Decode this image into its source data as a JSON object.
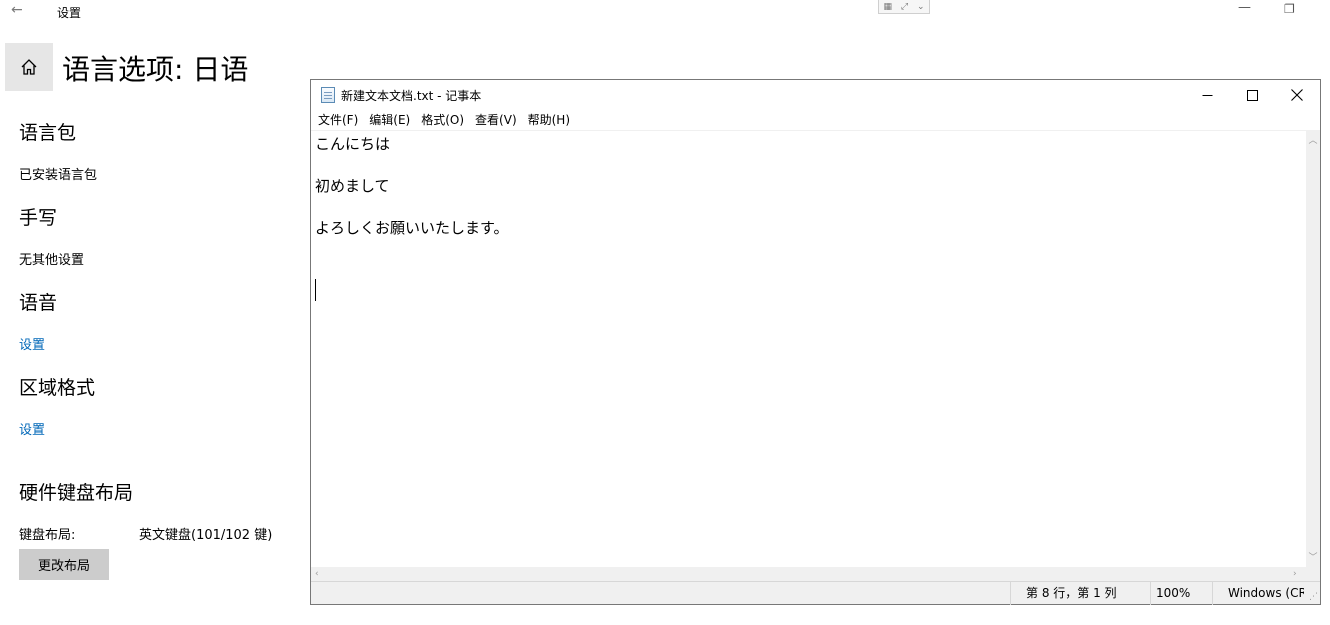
{
  "settings": {
    "window_title": "设置",
    "page_title": "语言选项: 日语",
    "sections": {
      "language_pack": {
        "heading": "语言包",
        "text": "已安装语言包"
      },
      "handwriting": {
        "heading": "手写",
        "text": "无其他设置"
      },
      "speech": {
        "heading": "语音",
        "link": "设置"
      },
      "regional": {
        "heading": "区域格式",
        "link": "设置"
      },
      "keyboard": {
        "heading": "硬件键盘布局",
        "label": "键盘布局:",
        "value": "英文键盘(101/102 键)",
        "button": "更改布局"
      }
    }
  },
  "notepad": {
    "title": "新建文本文档.txt - 记事本",
    "menu": [
      "文件(F)",
      "编辑(E)",
      "格式(O)",
      "查看(V)",
      "帮助(H)"
    ],
    "lines": [
      "こんにちは",
      "初めまして",
      "よろしくお願いいたします。"
    ],
    "status": {
      "position": "第 8 行，第 1 列",
      "zoom": "100%",
      "encoding": "Windows (CRLF)"
    }
  },
  "icons": {
    "back": "back-arrow-icon",
    "home": "home-icon",
    "minimize": "minimize-icon",
    "restore": "restore-icon",
    "maximize": "maximize-icon",
    "close": "close-icon",
    "notepad": "notepad-app-icon"
  }
}
